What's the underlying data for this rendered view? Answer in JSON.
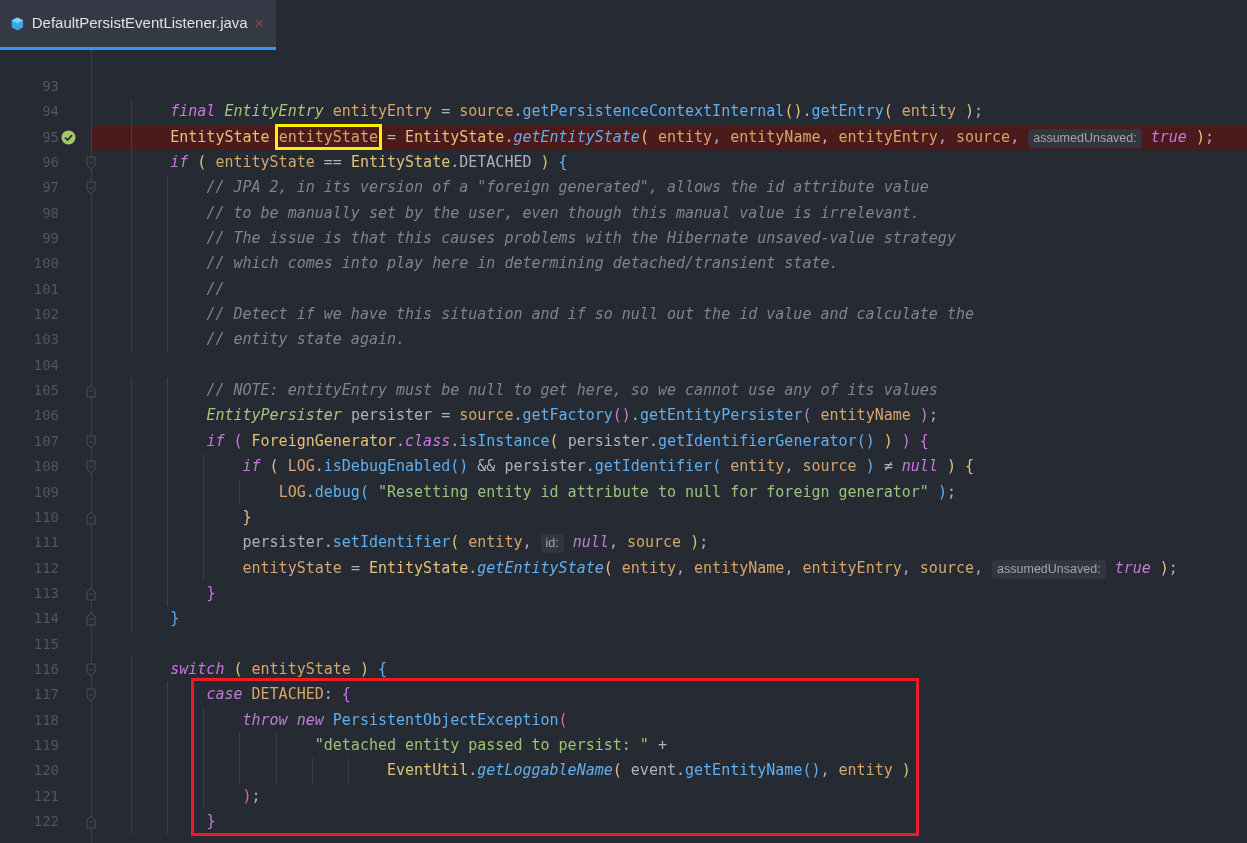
{
  "tab": {
    "title": "DefaultPersistEventListener.java",
    "selected": true,
    "close": "×"
  },
  "lines": [
    {
      "number": "93",
      "breakpoint": false,
      "framed": false,
      "fold_start": false,
      "fold_end": false
    },
    {
      "number": "94",
      "breakpoint": false,
      "framed": false,
      "fold_start": false,
      "fold_end": false,
      "tokens": [
        {
          "text": "        final ",
          "kind": "kw"
        },
        {
          "text": "EntityEntry ",
          "kind": "itype"
        },
        {
          "text": "entityEntry ",
          "kind": "var"
        },
        {
          "text": "= ",
          "kind": "plain"
        },
        {
          "text": "source",
          "kind": "var"
        },
        {
          "text": ".",
          "kind": "plain"
        },
        {
          "text": "getPersistenceContextInternal",
          "kind": "method"
        },
        {
          "text": "()",
          "kind": "b1"
        },
        {
          "text": ".",
          "kind": "plain"
        },
        {
          "text": "getEntry",
          "kind": "method"
        },
        {
          "text": "( ",
          "kind": "b1"
        },
        {
          "text": "entity ",
          "kind": "var"
        },
        {
          "text": ")",
          "kind": "b1"
        },
        {
          "text": ";",
          "kind": "plain"
        }
      ]
    },
    {
      "number": "95",
      "breakpoint": true,
      "framed": false,
      "fold_start": false,
      "fold_end": false,
      "tokens": [
        {
          "text": "        EntityState ",
          "kind": "type"
        },
        {
          "text": "entityState",
          "kind": "var",
          "outlined": true
        },
        {
          "text": " = ",
          "kind": "plain"
        },
        {
          "text": "EntityState",
          "kind": "type"
        },
        {
          "text": ".",
          "kind": "plain"
        },
        {
          "text": "getEntityState",
          "kind": "smethod"
        },
        {
          "text": "( ",
          "kind": "b1"
        },
        {
          "text": "entity",
          "kind": "var"
        },
        {
          "text": ", ",
          "kind": "plain"
        },
        {
          "text": "entityName",
          "kind": "var"
        },
        {
          "text": ", ",
          "kind": "plain"
        },
        {
          "text": "entityEntry",
          "kind": "var"
        },
        {
          "text": ", ",
          "kind": "plain"
        },
        {
          "text": "source",
          "kind": "var"
        },
        {
          "text": ", ",
          "kind": "plain"
        },
        {
          "text": "assumedUnsaved:",
          "kind": "hint"
        },
        {
          "text": " true ",
          "kind": "kw"
        },
        {
          "text": ")",
          "kind": "b1"
        },
        {
          "text": ";",
          "kind": "plain"
        }
      ]
    },
    {
      "number": "96",
      "breakpoint": false,
      "framed": false,
      "fold_start": true,
      "fold_end": false,
      "tokens": [
        {
          "text": "        if ",
          "kind": "kw"
        },
        {
          "text": "( ",
          "kind": "b1"
        },
        {
          "text": "entityState",
          "kind": "var"
        },
        {
          "text": " == ",
          "kind": "plain"
        },
        {
          "text": "EntityState",
          "kind": "type"
        },
        {
          "text": ".DETACHED ",
          "kind": "plain"
        },
        {
          "text": ")",
          "kind": "b1"
        },
        {
          "text": " {",
          "kind": "b3"
        }
      ]
    },
    {
      "number": "97",
      "breakpoint": false,
      "framed": false,
      "fold_start": true,
      "fold_end": false,
      "tokens": [
        {
          "text": "            // JPA 2, in its version of a \"foreign generated\", allows the id attribute value",
          "kind": "comment"
        }
      ]
    },
    {
      "number": "98",
      "breakpoint": false,
      "framed": false,
      "fold_start": false,
      "fold_end": false,
      "tokens": [
        {
          "text": "            // to be manually set by the user, even though this manual value is irrelevant.",
          "kind": "comment"
        }
      ]
    },
    {
      "number": "99",
      "breakpoint": false,
      "framed": false,
      "fold_start": false,
      "fold_end": false,
      "tokens": [
        {
          "text": "            // The issue is that this causes problems with the Hibernate unsaved-value strategy",
          "kind": "comment"
        }
      ]
    },
    {
      "number": "100",
      "breakpoint": false,
      "framed": false,
      "fold_start": false,
      "fold_end": false,
      "tokens": [
        {
          "text": "            // which comes into play here in determining detached/transient state.",
          "kind": "comment"
        }
      ]
    },
    {
      "number": "101",
      "breakpoint": false,
      "framed": false,
      "fold_start": false,
      "fold_end": false,
      "tokens": [
        {
          "text": "            //",
          "kind": "comment"
        }
      ]
    },
    {
      "number": "102",
      "breakpoint": false,
      "framed": false,
      "fold_start": false,
      "fold_end": false,
      "tokens": [
        {
          "text": "            // Detect if we have this situation and if so null out the id value and calculate the",
          "kind": "comment"
        }
      ]
    },
    {
      "number": "103",
      "breakpoint": false,
      "framed": false,
      "fold_start": false,
      "fold_end": false,
      "tokens": [
        {
          "text": "            // entity state again.",
          "kind": "comment"
        }
      ]
    },
    {
      "number": "104",
      "breakpoint": false,
      "framed": false,
      "fold_start": false,
      "fold_end": false
    },
    {
      "number": "105",
      "breakpoint": false,
      "framed": false,
      "fold_start": false,
      "fold_end": true,
      "tokens": [
        {
          "text": "            // NOTE: entityEntry must be null to get here, so we cannot use any of its values",
          "kind": "comment"
        }
      ]
    },
    {
      "number": "106",
      "breakpoint": false,
      "framed": false,
      "fold_start": false,
      "fold_end": false,
      "tokens": [
        {
          "text": "            EntityPersister ",
          "kind": "itype"
        },
        {
          "text": "persister = ",
          "kind": "plain"
        },
        {
          "text": "source",
          "kind": "var"
        },
        {
          "text": ".",
          "kind": "plain"
        },
        {
          "text": "getFactory",
          "kind": "method"
        },
        {
          "text": "()",
          "kind": "b2"
        },
        {
          "text": ".",
          "kind": "plain"
        },
        {
          "text": "getEntityPersister",
          "kind": "method"
        },
        {
          "text": "( ",
          "kind": "b2"
        },
        {
          "text": "entityName ",
          "kind": "var"
        },
        {
          "text": ")",
          "kind": "b2"
        },
        {
          "text": ";",
          "kind": "plain"
        }
      ]
    },
    {
      "number": "107",
      "breakpoint": false,
      "framed": false,
      "fold_start": true,
      "fold_end": false,
      "tokens": [
        {
          "text": "            if ",
          "kind": "kw"
        },
        {
          "text": "( ",
          "kind": "b2"
        },
        {
          "text": "ForeignGenerator",
          "kind": "type"
        },
        {
          "text": ".",
          "kind": "plain"
        },
        {
          "text": "class",
          "kind": "kw"
        },
        {
          "text": ".",
          "kind": "plain"
        },
        {
          "text": "isInstance",
          "kind": "method"
        },
        {
          "text": "( ",
          "kind": "b1"
        },
        {
          "text": "persister.",
          "kind": "plain"
        },
        {
          "text": "getIdentifierGenerator",
          "kind": "method"
        },
        {
          "text": "()",
          "kind": "b3"
        },
        {
          "text": " )",
          "kind": "b1"
        },
        {
          "text": " )",
          "kind": "b2"
        },
        {
          "text": " {",
          "kind": "b2"
        }
      ]
    },
    {
      "number": "108",
      "breakpoint": false,
      "framed": false,
      "fold_start": true,
      "fold_end": false,
      "tokens": [
        {
          "text": "                if ",
          "kind": "kw"
        },
        {
          "text": "( ",
          "kind": "b1"
        },
        {
          "text": "LOG",
          "kind": "var"
        },
        {
          "text": ".",
          "kind": "plain"
        },
        {
          "text": "isDebugEnabled",
          "kind": "method"
        },
        {
          "text": "()",
          "kind": "b3"
        },
        {
          "text": " && persister.",
          "kind": "plain"
        },
        {
          "text": "getIdentifier",
          "kind": "method"
        },
        {
          "text": "( ",
          "kind": "b3"
        },
        {
          "text": "entity",
          "kind": "var"
        },
        {
          "text": ", ",
          "kind": "plain"
        },
        {
          "text": "source ",
          "kind": "var"
        },
        {
          "text": ")",
          "kind": "b3"
        },
        {
          "text": " ≠ ",
          "kind": "plain"
        },
        {
          "text": "null ",
          "kind": "kw"
        },
        {
          "text": ")",
          "kind": "b1"
        },
        {
          "text": " {",
          "kind": "b1"
        }
      ]
    },
    {
      "number": "109",
      "breakpoint": false,
      "framed": false,
      "fold_start": false,
      "fold_end": false,
      "tokens": [
        {
          "text": "                    LOG",
          "kind": "var"
        },
        {
          "text": ".",
          "kind": "plain"
        },
        {
          "text": "debug",
          "kind": "method"
        },
        {
          "text": "( ",
          "kind": "b3"
        },
        {
          "text": "\"Resetting entity id attribute to null for foreign generator\" ",
          "kind": "string"
        },
        {
          "text": ")",
          "kind": "b3"
        },
        {
          "text": ";",
          "kind": "plain"
        }
      ]
    },
    {
      "number": "110",
      "breakpoint": false,
      "framed": false,
      "fold_start": false,
      "fold_end": true,
      "tokens": [
        {
          "text": "                }",
          "kind": "b1"
        }
      ]
    },
    {
      "number": "111",
      "breakpoint": false,
      "framed": false,
      "fold_start": false,
      "fold_end": false,
      "tokens": [
        {
          "text": "                persister.",
          "kind": "plain"
        },
        {
          "text": "setIdentifier",
          "kind": "method"
        },
        {
          "text": "( ",
          "kind": "b1"
        },
        {
          "text": "entity",
          "kind": "var"
        },
        {
          "text": ", ",
          "kind": "plain"
        },
        {
          "text": "id:",
          "kind": "hint"
        },
        {
          "text": " null",
          "kind": "kw"
        },
        {
          "text": ", ",
          "kind": "plain"
        },
        {
          "text": "source ",
          "kind": "var"
        },
        {
          "text": ")",
          "kind": "b1"
        },
        {
          "text": ";",
          "kind": "plain"
        }
      ]
    },
    {
      "number": "112",
      "breakpoint": false,
      "framed": false,
      "fold_start": false,
      "fold_end": false,
      "tokens": [
        {
          "text": "                entityState",
          "kind": "var"
        },
        {
          "text": " = ",
          "kind": "plain"
        },
        {
          "text": "EntityState",
          "kind": "type"
        },
        {
          "text": ".",
          "kind": "plain"
        },
        {
          "text": "getEntityState",
          "kind": "smethod"
        },
        {
          "text": "( ",
          "kind": "b1"
        },
        {
          "text": "entity",
          "kind": "var"
        },
        {
          "text": ", ",
          "kind": "plain"
        },
        {
          "text": "entityName",
          "kind": "var"
        },
        {
          "text": ", ",
          "kind": "plain"
        },
        {
          "text": "entityEntry",
          "kind": "var"
        },
        {
          "text": ", ",
          "kind": "plain"
        },
        {
          "text": "source",
          "kind": "var"
        },
        {
          "text": ", ",
          "kind": "plain"
        },
        {
          "text": "assumedUnsaved:",
          "kind": "hint"
        },
        {
          "text": " true ",
          "kind": "kw"
        },
        {
          "text": ")",
          "kind": "b1"
        },
        {
          "text": ";",
          "kind": "plain"
        }
      ]
    },
    {
      "number": "113",
      "breakpoint": false,
      "framed": false,
      "fold_start": false,
      "fold_end": true,
      "tokens": [
        {
          "text": "            }",
          "kind": "b2"
        }
      ]
    },
    {
      "number": "114",
      "breakpoint": false,
      "framed": false,
      "fold_start": false,
      "fold_end": true,
      "tokens": [
        {
          "text": "        }",
          "kind": "b3"
        }
      ]
    },
    {
      "number": "115",
      "breakpoint": false,
      "framed": false,
      "fold_start": false,
      "fold_end": false
    },
    {
      "number": "116",
      "breakpoint": false,
      "framed": false,
      "fold_start": true,
      "fold_end": false,
      "tokens": [
        {
          "text": "        switch ",
          "kind": "kw"
        },
        {
          "text": "( ",
          "kind": "b1"
        },
        {
          "text": "entityState ",
          "kind": "var"
        },
        {
          "text": ")",
          "kind": "b1"
        },
        {
          "text": " {",
          "kind": "b3"
        }
      ]
    },
    {
      "number": "117",
      "breakpoint": false,
      "framed": true,
      "fold_start": true,
      "fold_end": false,
      "tokens": [
        {
          "text": "            case ",
          "kind": "kw"
        },
        {
          "text": "DETACHED",
          "kind": "var"
        },
        {
          "text": ": ",
          "kind": "plain"
        },
        {
          "text": "{",
          "kind": "b2"
        }
      ]
    },
    {
      "number": "118",
      "breakpoint": false,
      "framed": true,
      "fold_start": false,
      "fold_end": false,
      "tokens": [
        {
          "text": "                throw new ",
          "kind": "kw"
        },
        {
          "text": "PersistentObjectException",
          "kind": "method"
        },
        {
          "text": "(",
          "kind": "b4"
        }
      ]
    },
    {
      "number": "119",
      "breakpoint": false,
      "framed": true,
      "fold_start": false,
      "fold_end": false,
      "tokens": [
        {
          "text": "                        \"detached entity passed to persist: \"",
          "kind": "string"
        },
        {
          "text": " +",
          "kind": "plain"
        }
      ]
    },
    {
      "number": "120",
      "breakpoint": false,
      "framed": true,
      "fold_start": false,
      "fold_end": false,
      "tokens": [
        {
          "text": "                                EventUtil",
          "kind": "type"
        },
        {
          "text": ".",
          "kind": "plain"
        },
        {
          "text": "getLoggableName",
          "kind": "smethod"
        },
        {
          "text": "( ",
          "kind": "b1"
        },
        {
          "text": "event.",
          "kind": "plain"
        },
        {
          "text": "getEntityName",
          "kind": "method"
        },
        {
          "text": "()",
          "kind": "b3"
        },
        {
          "text": ", ",
          "kind": "plain"
        },
        {
          "text": "entity ",
          "kind": "var"
        },
        {
          "text": ")",
          "kind": "b1"
        }
      ]
    },
    {
      "number": "121",
      "breakpoint": false,
      "framed": true,
      "fold_start": false,
      "fold_end": false,
      "tokens": [
        {
          "text": "                )",
          "kind": "b4"
        },
        {
          "text": ";",
          "kind": "plain"
        }
      ]
    },
    {
      "number": "122",
      "breakpoint": false,
      "framed": true,
      "fold_start": false,
      "fold_end": true,
      "tokens": [
        {
          "text": "            }",
          "kind": "b2"
        }
      ]
    }
  ]
}
